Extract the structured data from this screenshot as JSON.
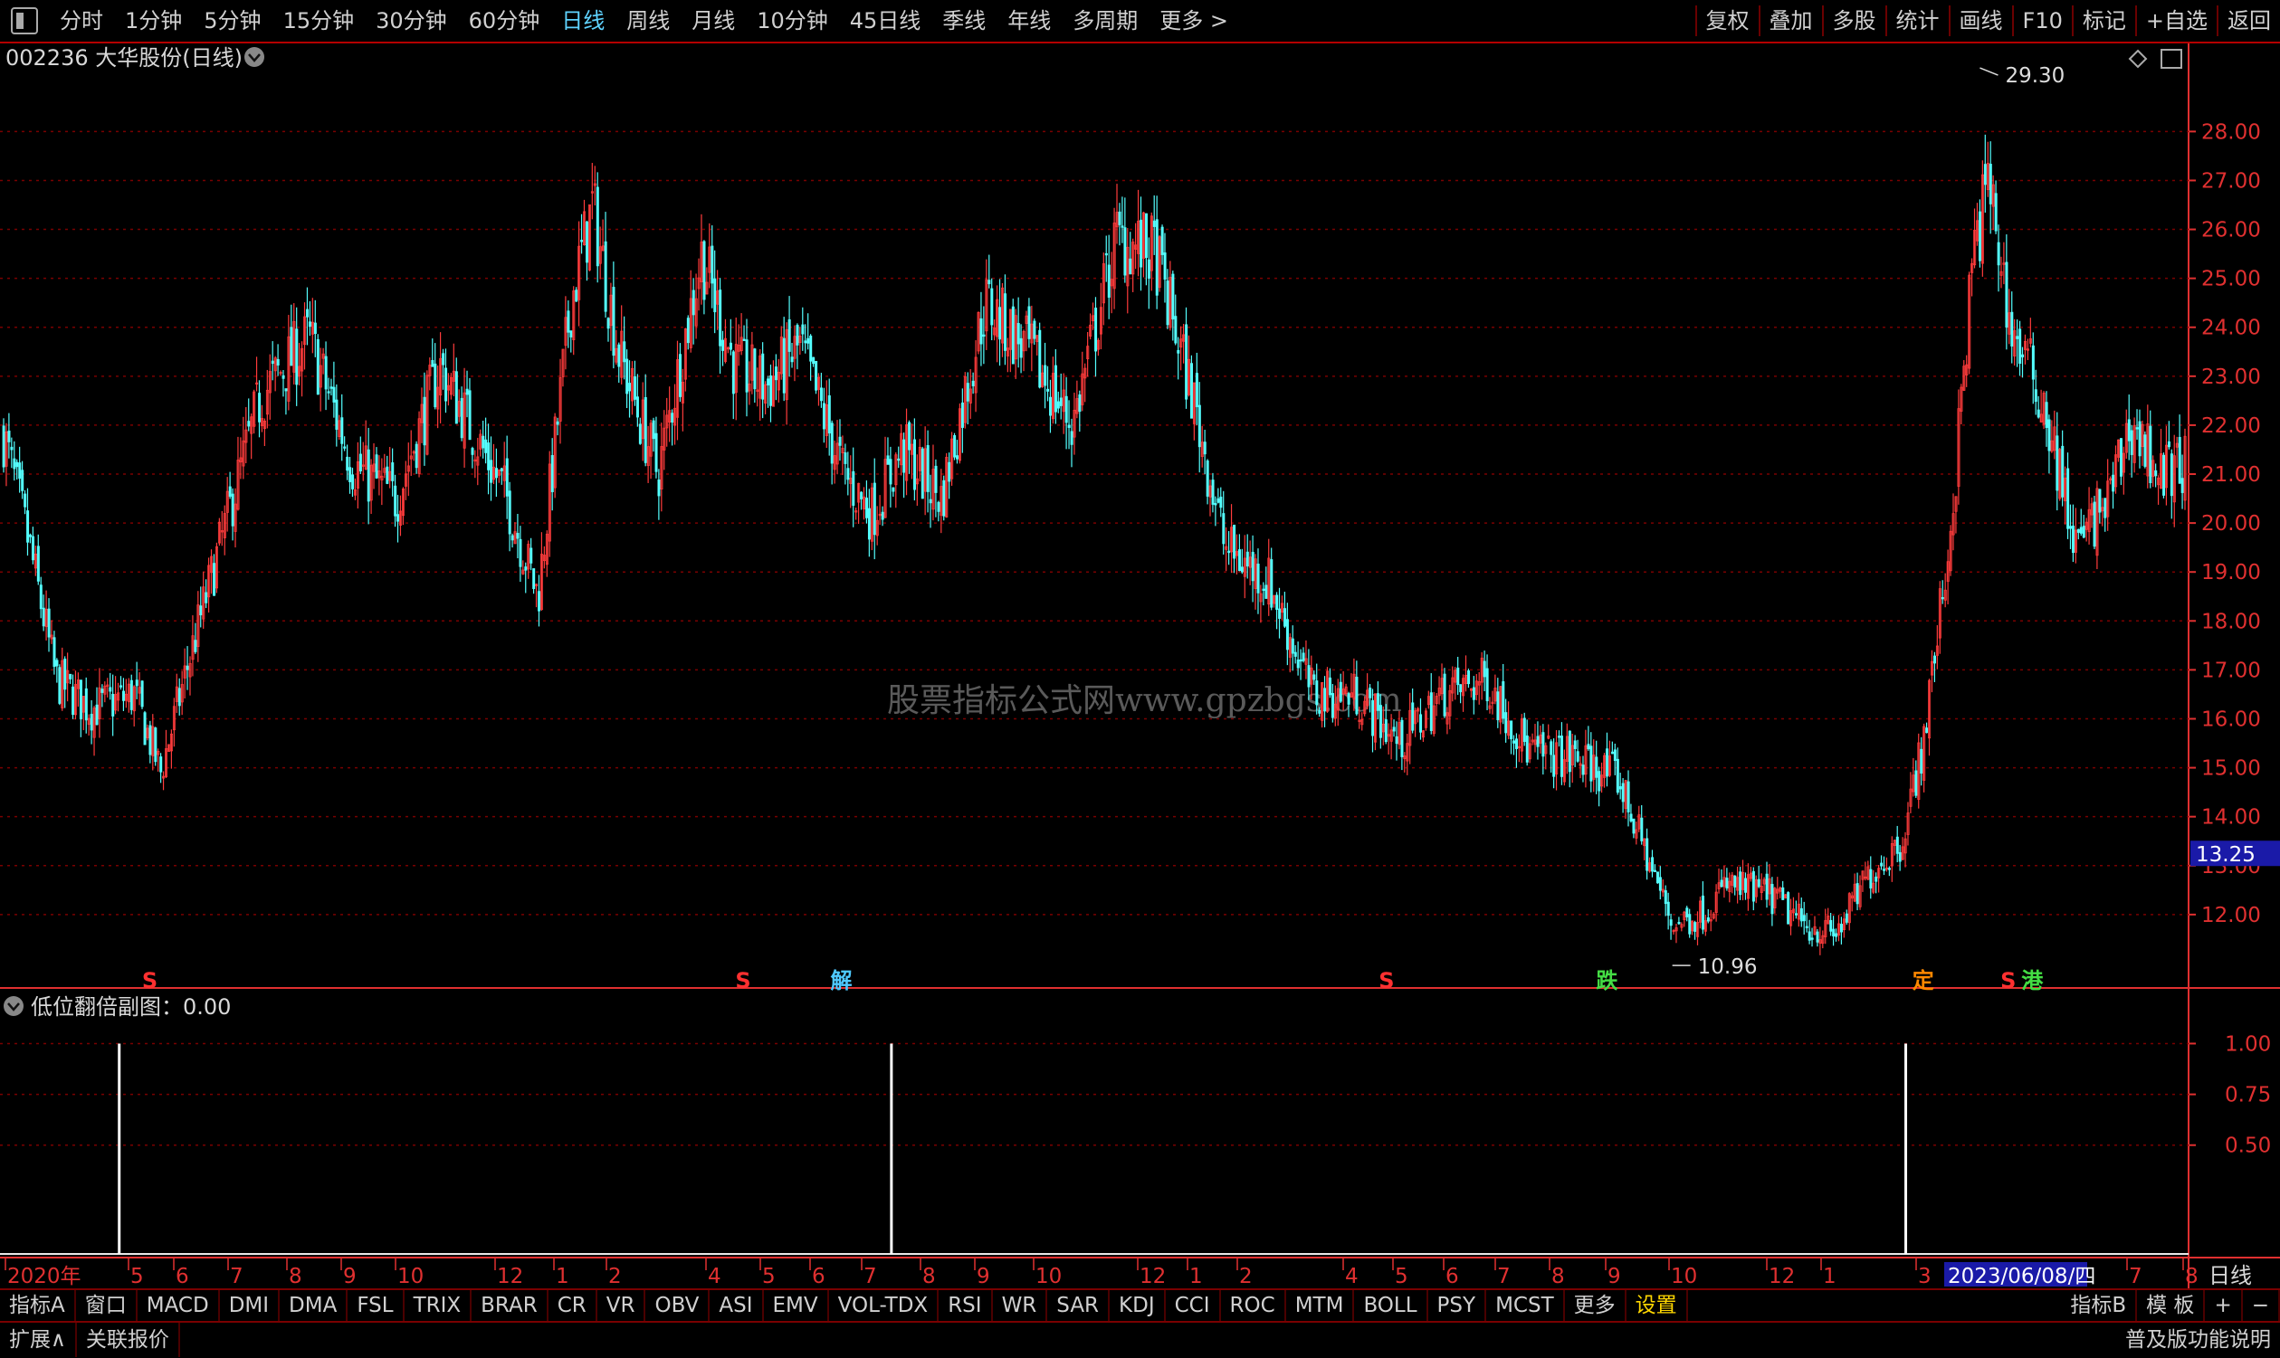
{
  "top_tabs": [
    "分时",
    "1分钟",
    "5分钟",
    "15分钟",
    "30分钟",
    "60分钟",
    "日线",
    "周线",
    "月线",
    "10分钟",
    "45日线",
    "季线",
    "年线",
    "多周期",
    "更多 >"
  ],
  "active_tab": "日线",
  "top_right_buttons": [
    "复权",
    "叠加",
    "多股",
    "统计",
    "画线",
    "F10",
    "标记",
    "+自选",
    "返回"
  ],
  "stock_title": "002236 大华股份(日线)",
  "watermark": "股票指标公式网www.gpzbgs.com",
  "price_axis_labels": [
    "28.00",
    "27.00",
    "26.00",
    "25.00",
    "24.00",
    "23.00",
    "22.00",
    "21.00",
    "20.00",
    "19.00",
    "18.00",
    "17.00",
    "16.00",
    "15.00",
    "14.00",
    "13.00",
    "12.00"
  ],
  "current_price_tag": "13.25",
  "high_label": "29.30",
  "low_label": "10.96",
  "signals": [
    {
      "text": "S",
      "color": "#ff3030"
    },
    {
      "text": "S",
      "color": "#ff3030"
    },
    {
      "text": "解",
      "color": "#4ec9ff"
    },
    {
      "text": "S",
      "color": "#ff3030"
    },
    {
      "text": "跌",
      "color": "#44dd44"
    },
    {
      "text": "定",
      "color": "#ff8800"
    },
    {
      "text": "S",
      "color": "#ff3030"
    },
    {
      "text": "港",
      "color": "#44dd44"
    }
  ],
  "sub_indicator_label": "低位翻倍副图：0.00",
  "sub_axis_labels": [
    "1.00",
    "0.75",
    "0.50"
  ],
  "date_axis_labels": [
    "2020年",
    "5",
    "6",
    "7",
    "8",
    "9",
    "10",
    "12",
    "1",
    "2",
    "4",
    "5",
    "6",
    "7",
    "8",
    "9",
    "10",
    "12",
    "1",
    "2",
    "4",
    "5",
    "6",
    "7",
    "8",
    "9",
    "10",
    "12",
    "1",
    "3",
    "7",
    "8"
  ],
  "date_highlight": "2023/06/08/四",
  "period_label": "日线",
  "indicator_tabs": [
    "指标A",
    "窗口",
    "MACD",
    "DMI",
    "DMA",
    "FSL",
    "TRIX",
    "BRAR",
    "CR",
    "VR",
    "OBV",
    "ASI",
    "EMV",
    "VOL-TDX",
    "RSI",
    "WR",
    "SAR",
    "KDJ",
    "CCI",
    "ROC",
    "MTM",
    "BOLL",
    "PSY",
    "MCST",
    "更多",
    "设置"
  ],
  "indicator_right": [
    "指标B",
    "模 板",
    "+",
    "−"
  ],
  "footer_left": [
    "扩展∧",
    "关联报价"
  ],
  "footer_right": "普及版功能说明",
  "colors": {
    "up": "#ff3c3c",
    "down": "#54ffff",
    "grid": "#7a0000",
    "axis": "#e03030",
    "tag_bg": "#1a1aa8"
  },
  "chart_data": {
    "type": "candlestick",
    "title": "002236 大华股份(日线)",
    "ylim": [
      10.5,
      29.8
    ],
    "price_high": 29.3,
    "price_low": 10.96,
    "last_price": 13.25,
    "close_path": [
      {
        "t": 0.0,
        "v": 21.8
      },
      {
        "t": 0.012,
        "v": 19.5
      },
      {
        "t": 0.024,
        "v": 16.8
      },
      {
        "t": 0.04,
        "v": 16.2
      },
      {
        "t": 0.06,
        "v": 16.5
      },
      {
        "t": 0.072,
        "v": 14.9
      },
      {
        "t": 0.085,
        "v": 17.2
      },
      {
        "t": 0.105,
        "v": 20.5
      },
      {
        "t": 0.118,
        "v": 22.6
      },
      {
        "t": 0.14,
        "v": 23.8
      },
      {
        "t": 0.16,
        "v": 21.2
      },
      {
        "t": 0.18,
        "v": 20.5
      },
      {
        "t": 0.2,
        "v": 23.2
      },
      {
        "t": 0.216,
        "v": 21.8
      },
      {
        "t": 0.23,
        "v": 20.6
      },
      {
        "t": 0.245,
        "v": 18.5
      },
      {
        "t": 0.26,
        "v": 24.5
      },
      {
        "t": 0.27,
        "v": 26.5
      },
      {
        "t": 0.282,
        "v": 23.5
      },
      {
        "t": 0.3,
        "v": 21.0
      },
      {
        "t": 0.32,
        "v": 25.5
      },
      {
        "t": 0.335,
        "v": 23.2
      },
      {
        "t": 0.35,
        "v": 22.8
      },
      {
        "t": 0.365,
        "v": 23.6
      },
      {
        "t": 0.385,
        "v": 21.0
      },
      {
        "t": 0.398,
        "v": 20.2
      },
      {
        "t": 0.412,
        "v": 21.5
      },
      {
        "t": 0.43,
        "v": 20.5
      },
      {
        "t": 0.45,
        "v": 24.5
      },
      {
        "t": 0.47,
        "v": 23.5
      },
      {
        "t": 0.49,
        "v": 22.0
      },
      {
        "t": 0.51,
        "v": 25.8
      },
      {
        "t": 0.528,
        "v": 25.5
      },
      {
        "t": 0.545,
        "v": 22.6
      },
      {
        "t": 0.56,
        "v": 19.5
      },
      {
        "t": 0.58,
        "v": 18.8
      },
      {
        "t": 0.6,
        "v": 16.5
      },
      {
        "t": 0.62,
        "v": 16.5
      },
      {
        "t": 0.64,
        "v": 15.5
      },
      {
        "t": 0.66,
        "v": 16.5
      },
      {
        "t": 0.68,
        "v": 16.8
      },
      {
        "t": 0.7,
        "v": 15.3
      },
      {
        "t": 0.72,
        "v": 15.2
      },
      {
        "t": 0.74,
        "v": 14.8
      },
      {
        "t": 0.755,
        "v": 13.0
      },
      {
        "t": 0.765,
        "v": 11.8
      },
      {
        "t": 0.778,
        "v": 12.0
      },
      {
        "t": 0.79,
        "v": 12.6
      },
      {
        "t": 0.81,
        "v": 12.4
      },
      {
        "t": 0.825,
        "v": 11.8
      },
      {
        "t": 0.84,
        "v": 11.6
      },
      {
        "t": 0.855,
        "v": 12.8
      },
      {
        "t": 0.87,
        "v": 13.5
      },
      {
        "t": 0.88,
        "v": 15.5
      },
      {
        "t": 0.893,
        "v": 20.0
      },
      {
        "t": 0.903,
        "v": 25.5
      },
      {
        "t": 0.91,
        "v": 27.0
      },
      {
        "t": 0.92,
        "v": 24.0
      },
      {
        "t": 0.935,
        "v": 22.5
      },
      {
        "t": 0.95,
        "v": 19.5
      },
      {
        "t": 0.965,
        "v": 20.5
      },
      {
        "t": 0.975,
        "v": 22.0
      },
      {
        "t": 0.99,
        "v": 21.0
      },
      {
        "t": 1.0,
        "v": 21.2
      }
    ],
    "sub_indicator": {
      "name": "低位翻倍副图",
      "ylim": [
        0,
        1.1
      ],
      "spikes": [
        {
          "t": 0.053,
          "v": 1.0
        },
        {
          "t": 0.407,
          "v": 1.0
        },
        {
          "t": 0.872,
          "v": 1.0
        }
      ]
    }
  }
}
